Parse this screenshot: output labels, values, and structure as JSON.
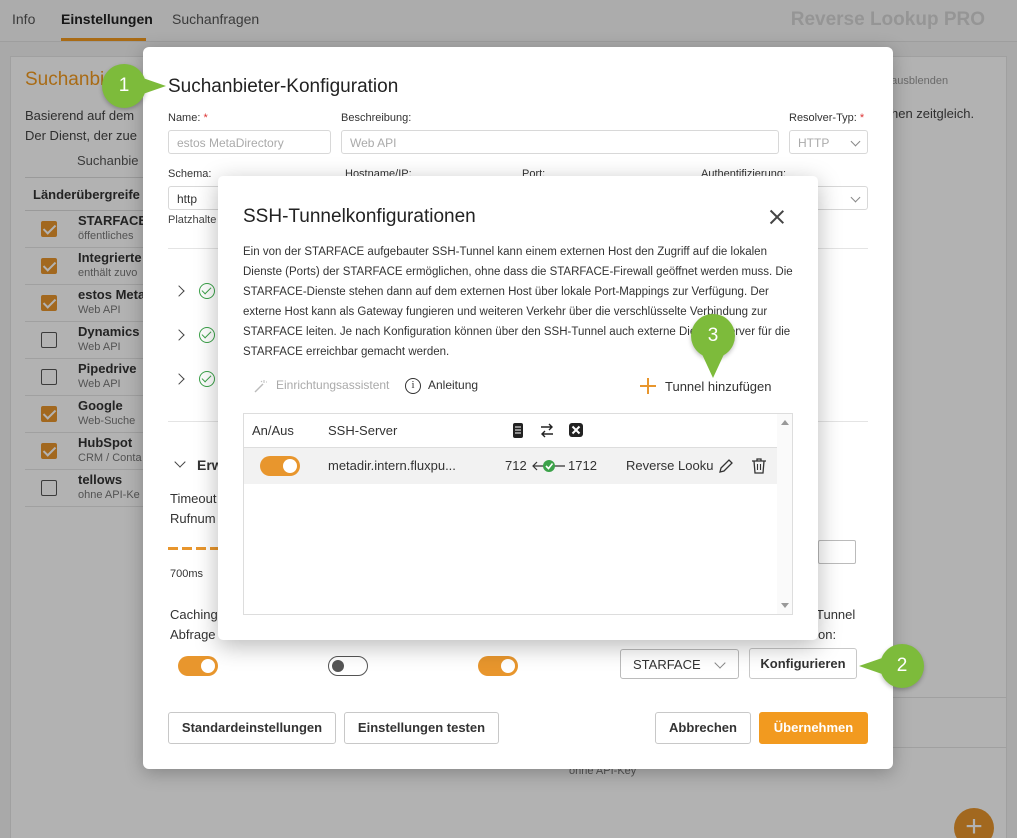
{
  "topbar": {
    "tabs": [
      {
        "label": "Info"
      },
      {
        "label": "Einstellungen"
      },
      {
        "label": "Suchanfragen"
      }
    ],
    "brand": "Reverse Lookup PRO"
  },
  "background": {
    "title": "Suchanbi",
    "hide_inactive": "tive ausblenden",
    "desc_line1": "Basierend auf dem",
    "desc_line2": "Der Dienst, der zue",
    "desc_right": "hen zeitgleich.",
    "column_header": "Suchanbie",
    "group": "Länderübergreife",
    "providers": [
      {
        "name": "STARFACE",
        "sub": "öffentliches",
        "checked": true
      },
      {
        "name": "Integrierte",
        "sub": "enthält zuvo",
        "checked": true
      },
      {
        "name": "estos Meta",
        "sub": "Web API",
        "checked": true
      },
      {
        "name": "Dynamics",
        "sub": "Web API",
        "checked": false
      },
      {
        "name": "Pipedrive",
        "sub": "Web API",
        "checked": false
      },
      {
        "name": "Google",
        "sub": "Web-Suche",
        "checked": true
      },
      {
        "name": "HubSpot",
        "sub": "CRM / Conta",
        "checked": true
      },
      {
        "name": "tellows",
        "sub": "ohne API-Ke",
        "checked": false
      }
    ],
    "api_key_text": "ohne API-Key",
    "fab_label": "+"
  },
  "dialog": {
    "title": "Suchanbieter-Konfiguration",
    "name_label": "Name:",
    "name_placeholder": "estos MetaDirectory",
    "desc_label": "Beschreibung:",
    "desc_placeholder": "Web API",
    "resolver_label": "Resolver-Typ:",
    "resolver_value": "HTTP",
    "schema_label": "Schema:",
    "schema_value": "http",
    "hostname_label": "Hostname/IP:",
    "port_label": "Port:",
    "auth_label": "Authentifizierung:",
    "placeholder_label": "Platzhalte",
    "expand_section": "Erw",
    "timeout_label": "Timeout",
    "rufnum_label": "Rufnum",
    "slider_value": "700ms",
    "caching_label": "Caching",
    "abfrage_label": "Abfrage",
    "tunnel_label": "Tunnel",
    "tunnel_label2": "on:",
    "tunnel_select": "STARFACE",
    "configure_button": "Konfigurieren",
    "defaults_button": "Standardeinstellungen",
    "test_button": "Einstellungen testen",
    "cancel_button": "Abbrechen",
    "apply_button": "Übernehmen",
    "required_mark": "*"
  },
  "ssh": {
    "title": "SSH-Tunnelkonfigurationen",
    "description": "Ein von der STARFACE aufgebauter SSH-Tunnel kann einem externen Host den Zugriff auf die lokalen Dienste (Ports) der STARFACE ermöglichen, ohne dass die STARFACE-Firewall geöffnet werden muss. Die STARFACE-Dienste stehen dann auf dem externen Host über lokale Port-Mappings zur Verfügung. Der externe Host kann als Gateway fungieren und weiteren Verkehr über die verschlüsselte Verbindung zur STARFACE leiten. Je nach Konfiguration können über den SSH-Tunnel auch externe Dienste/Server für die STARFACE erreichbar gemacht werden.",
    "wizard_label": "Einrichtungsassistent",
    "guide_label": "Anleitung",
    "add_tunnel_label": "Tunnel hinzufügen",
    "columns": {
      "on_off": "An/Aus",
      "server": "SSH-Server"
    },
    "rows": [
      {
        "enabled": true,
        "server": "metadir.intern.fluxpu...",
        "remote_port": "712",
        "local_port": "1712",
        "name": "Reverse Looku"
      }
    ]
  },
  "callouts": [
    "1",
    "2",
    "3"
  ],
  "colors": {
    "accent": "#f29a1f",
    "success": "#3ca24a",
    "callout": "#7dbb3b"
  }
}
